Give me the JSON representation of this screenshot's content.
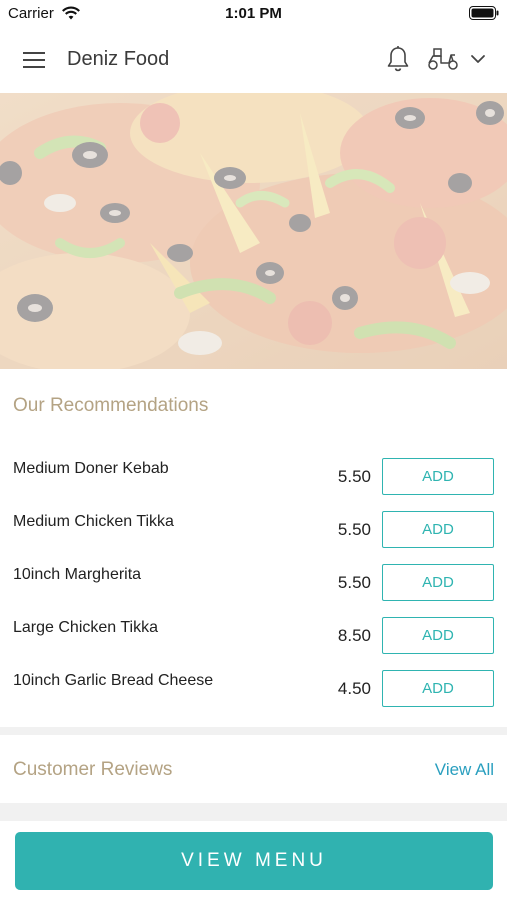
{
  "status_bar": {
    "carrier": "Carrier",
    "time": "1:01 PM",
    "wifi_icon": "wifi-icon",
    "battery_icon": "battery-icon"
  },
  "header": {
    "title": "Deniz Food",
    "menu_icon": "menu-icon",
    "bell_icon": "bell-icon",
    "delivery_icon": "scooter-icon",
    "dropdown_icon": "chevron-down-icon"
  },
  "recommendations": {
    "title": "Our Recommendations",
    "items": [
      {
        "name": "Medium Doner Kebab",
        "price": "5.50",
        "button": "ADD"
      },
      {
        "name": "Medium Chicken Tikka",
        "price": "5.50",
        "button": "ADD"
      },
      {
        "name": "10inch Margherita",
        "price": "5.50",
        "button": "ADD"
      },
      {
        "name": "Large Chicken Tikka",
        "price": "8.50",
        "button": "ADD"
      },
      {
        "name": "10inch Garlic Bread Cheese",
        "price": "4.50",
        "button": "ADD"
      }
    ]
  },
  "reviews": {
    "title": "Customer Reviews",
    "view_all": "View All"
  },
  "footer": {
    "view_menu": "VIEW MENU"
  },
  "colors": {
    "accent": "#30b2b0",
    "section_title": "#b4a384",
    "link": "#2a9fbf"
  }
}
